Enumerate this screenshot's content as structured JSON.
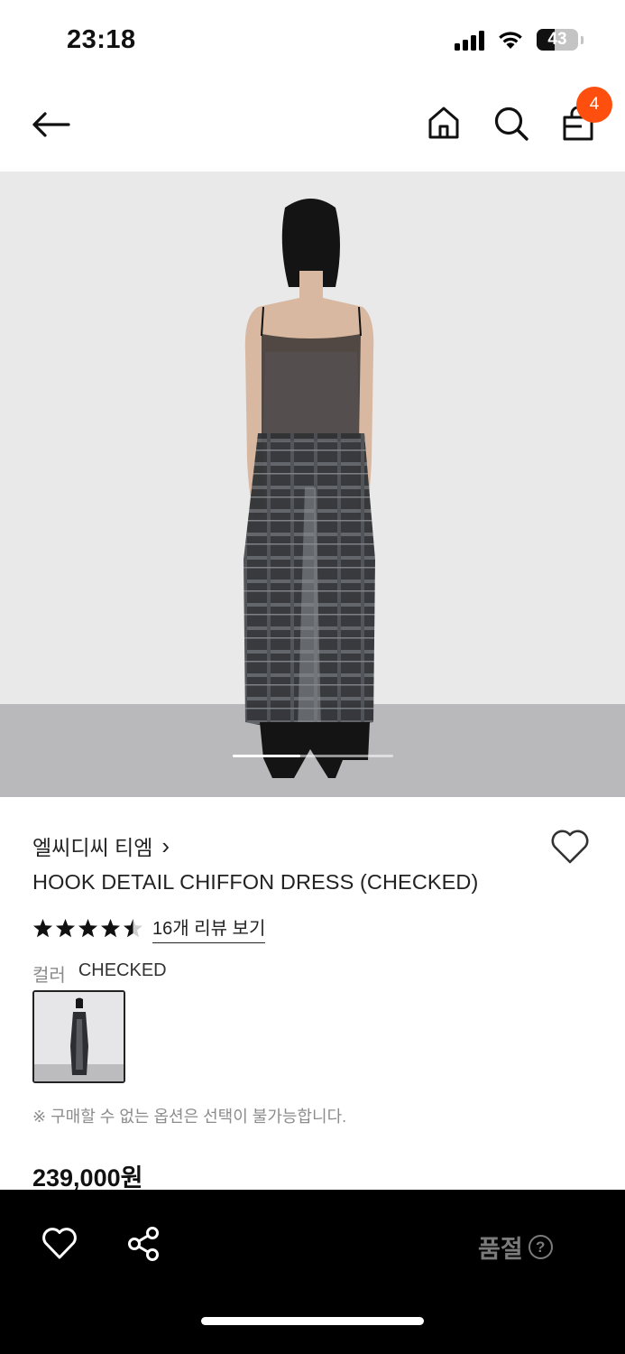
{
  "status_bar": {
    "time": "23:18",
    "battery": "43",
    "battery_fraction": 0.43
  },
  "nav": {
    "cart_count": "4",
    "icons": [
      "back-arrow-icon",
      "home-icon",
      "search-icon",
      "shopping-bag-icon"
    ]
  },
  "hero": {
    "carousel_progress_fraction": 0.42
  },
  "product": {
    "brand": "엘씨디씨 티엠",
    "brand_chevron": "›",
    "name": "HOOK DETAIL CHIFFON DRESS (CHECKED)",
    "rating": 4.5,
    "review_link": "16개 리뷰 보기",
    "color_label": "컬러",
    "color_value": "CHECKED",
    "notice": "※ 구매할 수 없는 옵션은 선택이 불가능합니다.",
    "price": "239,000원"
  },
  "bottom_bar": {
    "soldout_label": "품절",
    "help_glyph": "?"
  },
  "colors": {
    "badge": "#ff4f0f",
    "bottom_bar": "#000000",
    "soldout_text": "#7b7b7b",
    "star": "#111111"
  }
}
